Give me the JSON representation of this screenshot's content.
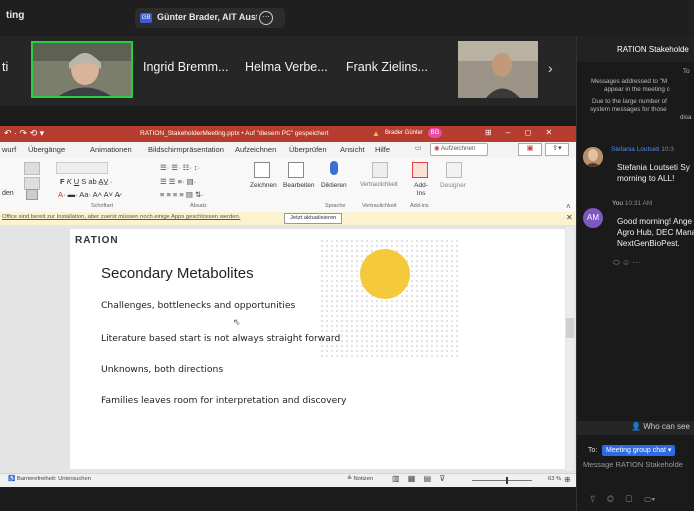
{
  "meeting": {
    "window_title": "ting",
    "screen_share_initials": "GB",
    "screen_share_name": "Günter Brader, AIT Austrian I..."
  },
  "participants": [
    {
      "name_partial": "ti"
    },
    {
      "name": "Ingrid Bremm..."
    },
    {
      "name": "Helma Verbe..."
    },
    {
      "name": "Frank Zielins..."
    }
  ],
  "ppt": {
    "title_bar_text": "RATION_StakeholderMeeting.pptx • Auf \"diesem PC\" gespeichert",
    "user_name": "Brader Günter",
    "user_initials": "BG",
    "tabs": [
      "wurf",
      "Übergänge",
      "Animationen",
      "Bildschirmpräsentation",
      "Aufzeichnen",
      "Überprüfen",
      "Ansicht",
      "Hilfe"
    ],
    "record_button": "Aufzeichnen",
    "groups": {
      "schriftart": "Schriftart",
      "absatz": "Absatz",
      "sprache": "Sprache",
      "vertraulichkeit": "Vertraulichkeit",
      "addins": "Add-ins"
    },
    "ribbon_labels": {
      "zeichnen": "Zeichnen",
      "bearbeiten": "Bearbeiten",
      "diktieren": "Diktieren",
      "vertraulichkeit": "Vertraulichkeit",
      "addins": "Add-Ins",
      "designer": "Designer",
      "den": "den"
    },
    "notice_text": "Office sind bereit zur Installation, aber zuerst müssen noch einige Apps geschlossen werden.",
    "notice_button": "Jetzt aktualisieren",
    "status_left": "Barrierefreiheit: Untersuchen",
    "status_notes": "Notizen",
    "zoom": "63 %"
  },
  "slide": {
    "logo": "RATION",
    "title": "Secondary Metabolites",
    "bullets": [
      "Challenges, bottlenecks and opportunities",
      "Literature based start is not always straight forward",
      "Unknowns, both directions",
      "Families leaves room for interpretation and discovery"
    ]
  },
  "chat": {
    "header": "RATION Stakeholde",
    "sys_to": "To",
    "sys_line1": "Messages addressed to \"M",
    "sys_line2": "appear in the meeting c",
    "sys_line3": "Due to the large number of",
    "sys_line4": "system messages for those",
    "sys_line5": "disa",
    "messages": [
      {
        "sender": "Stefania Loutseti",
        "time": "10:3",
        "text1": "Stefania Loutseti Sy",
        "text2": "morning to ALL!"
      },
      {
        "sender": "You",
        "time": "10:31 AM",
        "avatar": "AM",
        "text1": "Good morning! Ange",
        "text2": "Agro Hub, DEC Mana",
        "text3": "NextGenBioPest."
      }
    ],
    "who_can_see": "Who can see",
    "to_label": "To:",
    "to_target": "Meeting group chat",
    "input_placeholder": "Message RATION Stakeholde"
  },
  "colors": {
    "ppt_red": "#b73c30",
    "active_speaker": "#2ecc40",
    "chat_blue": "#4d8bf5",
    "slide_circle": "#f5c93c"
  }
}
